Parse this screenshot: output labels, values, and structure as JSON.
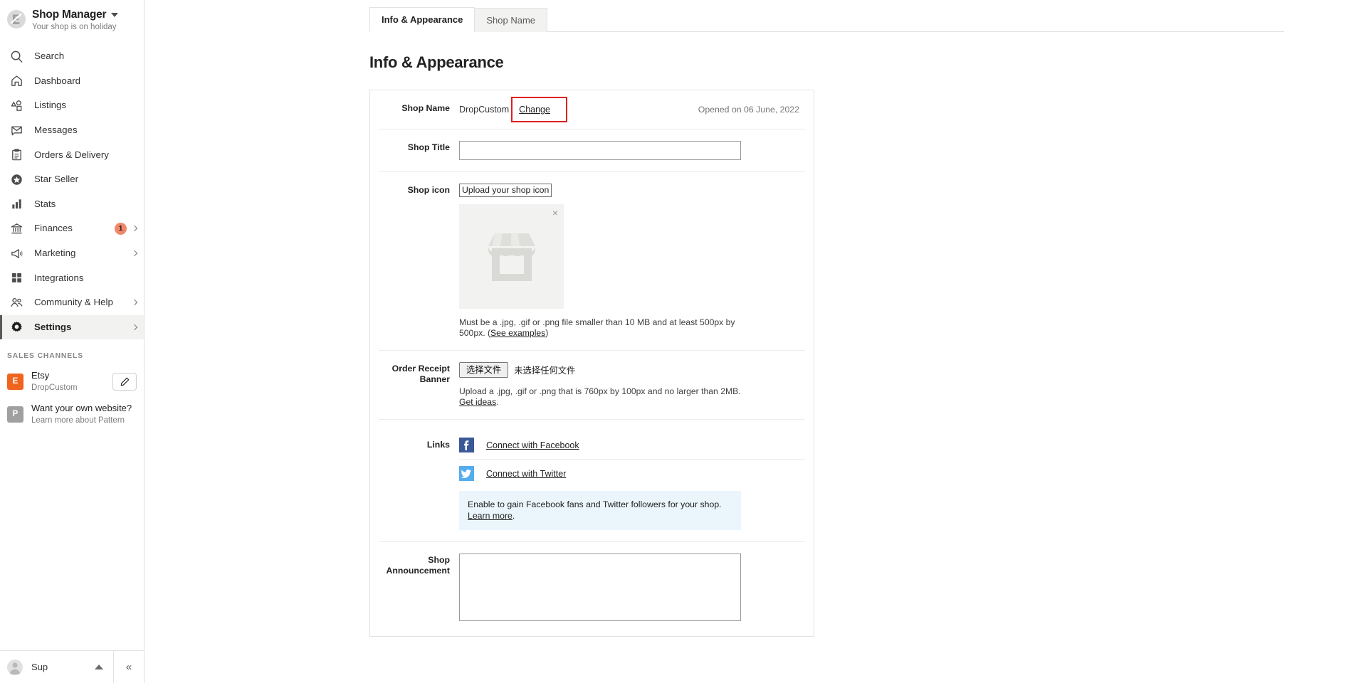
{
  "sidebar": {
    "shop": {
      "title": "Shop Manager",
      "subtitle": "Your shop is on holiday",
      "avatar_icon": "etsy-shop-avatar-icon",
      "caret_icon": "caret-down-icon"
    },
    "nav": [
      {
        "label": "Search",
        "icon": "search-icon",
        "badge": "",
        "chevron": false,
        "active": false
      },
      {
        "label": "Dashboard",
        "icon": "home-icon",
        "badge": "",
        "chevron": false,
        "active": false
      },
      {
        "label": "Listings",
        "icon": "shapes-icon",
        "badge": "",
        "chevron": false,
        "active": false
      },
      {
        "label": "Messages",
        "icon": "envelope-icon",
        "badge": "",
        "chevron": false,
        "active": false
      },
      {
        "label": "Orders & Delivery",
        "icon": "clipboard-icon",
        "badge": "",
        "chevron": false,
        "active": false
      },
      {
        "label": "Star Seller",
        "icon": "star-badge-icon",
        "badge": "",
        "chevron": false,
        "active": false
      },
      {
        "label": "Stats",
        "icon": "bar-chart-icon",
        "badge": "",
        "chevron": false,
        "active": false
      },
      {
        "label": "Finances",
        "icon": "bank-icon",
        "badge": "1",
        "chevron": true,
        "active": false
      },
      {
        "label": "Marketing",
        "icon": "megaphone-icon",
        "badge": "",
        "chevron": true,
        "active": false
      },
      {
        "label": "Integrations",
        "icon": "grid-icon",
        "badge": "",
        "chevron": false,
        "active": false
      },
      {
        "label": "Community & Help",
        "icon": "people-icon",
        "badge": "",
        "chevron": true,
        "active": false
      },
      {
        "label": "Settings",
        "icon": "gear-icon",
        "badge": "",
        "chevron": true,
        "active": true
      }
    ],
    "sales_channels": {
      "heading": "Sales Channels",
      "items": [
        {
          "logo_letter": "E",
          "logo_color": "#f1641e",
          "name": "Etsy",
          "sub": "DropCustom",
          "has_edit": true,
          "edit_icon": "pencil-icon"
        },
        {
          "logo_letter": "P",
          "logo_color": "#a0a0a0",
          "name": "Want your own website?",
          "sub": "Learn more about Pattern",
          "has_edit": false,
          "edit_icon": ""
        }
      ]
    },
    "footer": {
      "user_name": "Sup",
      "avatar_icon": "user-avatar-icon",
      "caret_icon": "caret-up-icon",
      "collapse_icon": "collapse-sidebar-icon",
      "collapse_glyph": "«"
    }
  },
  "main": {
    "tabs": [
      {
        "label": "Info & Appearance",
        "active": true
      },
      {
        "label": "Shop Name",
        "active": false
      }
    ],
    "page_title": "Info & Appearance",
    "shop_name": {
      "label": "Shop Name",
      "value": "DropCustom",
      "change_link": "Change",
      "opened_on": "Opened on 06 June, 2022",
      "highlight_color": "#e02020"
    },
    "shop_title": {
      "label": "Shop Title",
      "value": "",
      "placeholder": ""
    },
    "shop_icon": {
      "label": "Shop icon",
      "upload_caption": "Upload your shop icon",
      "remove_icon": "close-icon",
      "remove_glyph": "×",
      "placeholder_icon": "storefront-placeholder-icon",
      "help_text": "Must be a .jpg, .gif or .png file smaller than 10 MB and at least 500px by 500px. (",
      "help_link": "See examples",
      "help_text_end": ")"
    },
    "order_receipt_banner": {
      "label": "Order Receipt Banner",
      "choose_file_button": "选择文件",
      "no_file_text": "未选择任何文件",
      "help_text": "Upload a .jpg, .gif or .png that is 760px by 100px and no larger than 2MB. ",
      "help_link": "Get ideas",
      "help_text_end": "."
    },
    "links": {
      "label": "Links",
      "items": [
        {
          "label": "Connect with Facebook",
          "icon": "facebook-icon",
          "glyph": "f",
          "color": "#3b5998"
        },
        {
          "label": "Connect with Twitter",
          "icon": "twitter-icon",
          "glyph": "t",
          "color": "#55acee"
        }
      ],
      "notice_text": "Enable to gain Facebook fans and Twitter followers for your shop. ",
      "notice_link": "Learn more",
      "notice_text_end": "."
    },
    "shop_announcement": {
      "label": "Shop Announcement",
      "value": ""
    }
  }
}
